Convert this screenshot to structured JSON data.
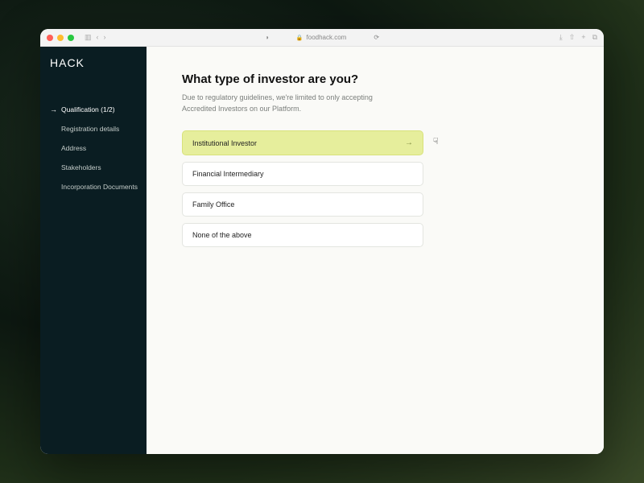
{
  "browser": {
    "url": "foodhack.com"
  },
  "sidebar": {
    "logo": "HACK",
    "items": [
      {
        "label": "Qualification (1/2)",
        "active": true
      },
      {
        "label": "Registration details"
      },
      {
        "label": "Address"
      },
      {
        "label": "Stakeholders"
      },
      {
        "label": "Incorporation Documents"
      }
    ]
  },
  "page": {
    "title": "What type of investor are you?",
    "subtitle": "Due to regulatory guidelines, we're limited to only accepting Accredited Investors on our Platform."
  },
  "options": [
    {
      "label": "Institutional Investor",
      "selected": true
    },
    {
      "label": "Financial Intermediary"
    },
    {
      "label": "Family Office"
    },
    {
      "label": "None of the above"
    }
  ]
}
